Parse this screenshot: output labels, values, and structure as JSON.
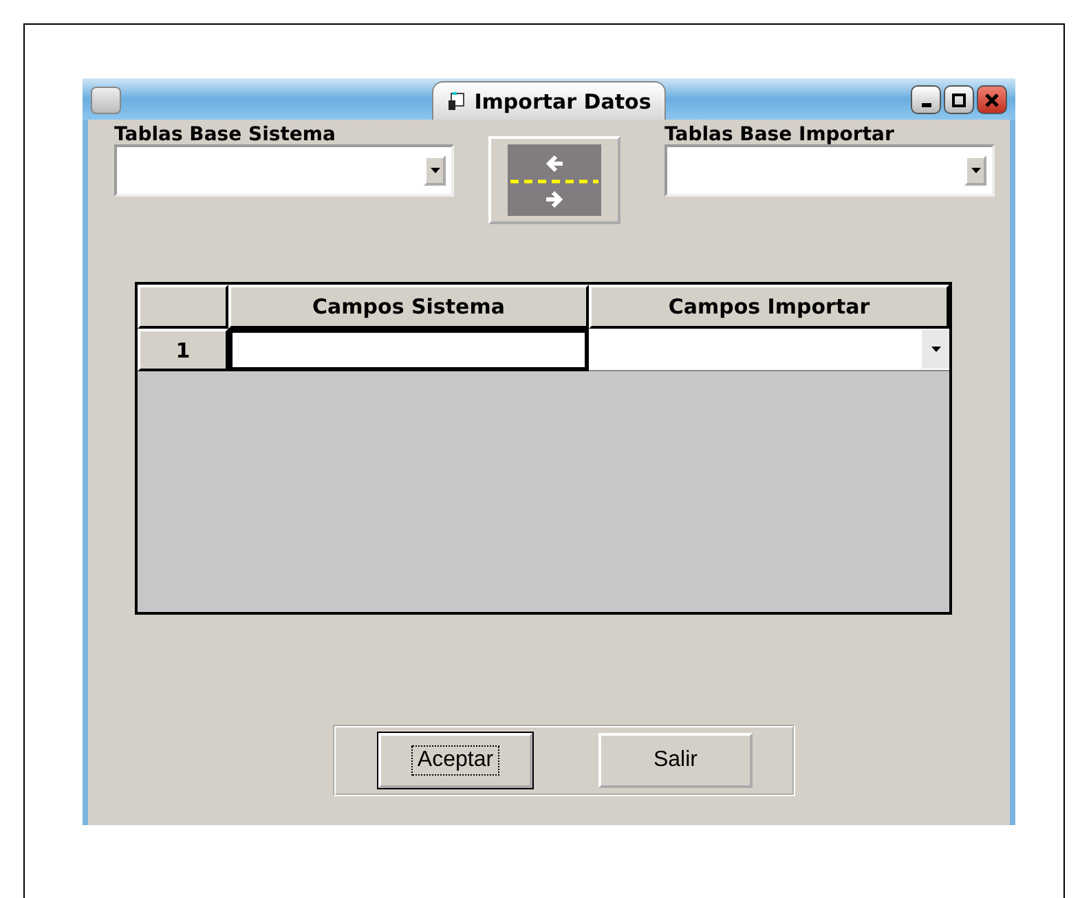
{
  "window": {
    "title": "Importar Datos"
  },
  "left_table": {
    "label": "Tablas Base Sistema"
  },
  "right_table": {
    "label": "Tablas Base Importar"
  },
  "grid": {
    "columns": [
      "Campos Sistema",
      "Campos Importar"
    ],
    "rows": [
      {
        "number": "1"
      }
    ]
  },
  "buttons": [
    {
      "label": "Aceptar",
      "focused": true
    },
    {
      "label": "Salir",
      "focused": false
    }
  ]
}
